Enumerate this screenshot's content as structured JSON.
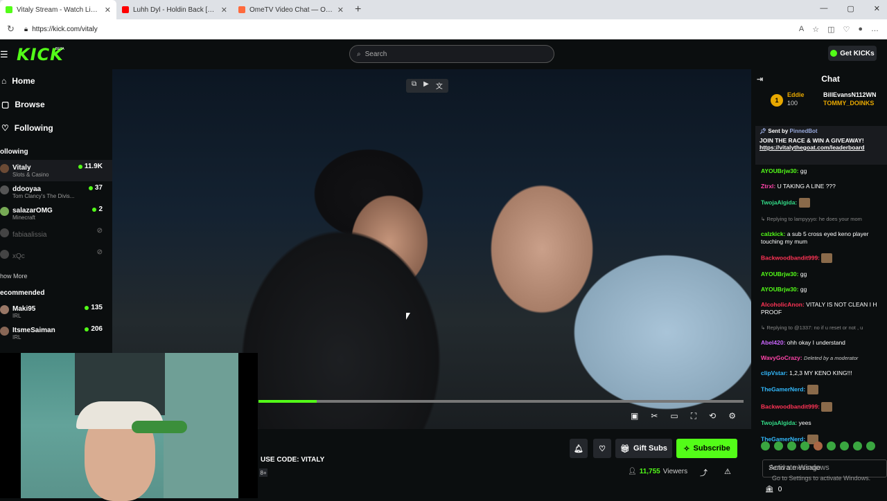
{
  "browser": {
    "tabs": [
      {
        "title": "Vitaly Stream - Watch Live on",
        "color": "#53fc18",
        "active": true
      },
      {
        "title": "Luhh Dyl - Holdin Back [Official Vi",
        "color": "#ff0000",
        "active": false
      },
      {
        "title": "OmeTV Video Chat — Omegle",
        "color": "#ff6a3d",
        "active": false
      }
    ],
    "url": "https://kick.com/vitaly"
  },
  "header": {
    "logo": "KICK",
    "beta": "BETA",
    "search_placeholder": "Search",
    "get_kicks": "Get KICKs"
  },
  "sidebar": {
    "nav": [
      {
        "icon": "⌂",
        "label": "Home"
      },
      {
        "icon": "▢",
        "label": "Browse"
      },
      {
        "icon": "♡",
        "label": "Following"
      }
    ],
    "following_heading": "ollowing",
    "following": [
      {
        "name": "Vitaly",
        "category": "Slots & Casino",
        "viewers": "11.9K",
        "live": true
      },
      {
        "name": "ddooyaa",
        "category": "Tom Clancy's The Divis...",
        "viewers": "37",
        "live": true
      },
      {
        "name": "salazarOMG",
        "category": "Minecraft",
        "viewers": "2",
        "live": true
      },
      {
        "name": "fabiaalissia",
        "category": "",
        "viewers": "",
        "live": false
      },
      {
        "name": "xQc",
        "category": "",
        "viewers": "",
        "live": false
      }
    ],
    "show_more": "how More",
    "recommended_heading": "ecommended",
    "recommended": [
      {
        "name": "Maki95",
        "category": "IRL",
        "viewers": "135"
      },
      {
        "name": "ItsmeSaiman",
        "category": "IRL",
        "viewers": "206"
      }
    ]
  },
  "player": {
    "progress": 0.12,
    "code_text": "USE CODE: VITALY",
    "tag": "8+",
    "gift_subs": "Gift Subs",
    "subscribe": "Subscribe",
    "viewer_count": "11,755",
    "viewers_label": "Viewers"
  },
  "chat": {
    "title": "Chat",
    "leaders": {
      "rank": "1",
      "top_name": "Eddie",
      "top_value": "100",
      "gifter1": "BillEvansN112WN",
      "gifter2": "TOMMY_DOINKS"
    },
    "pinned": {
      "sent_by": "Sent by",
      "bot": "PinnedBot",
      "message": "JOIN THE RACE & WIN A GIVEAWAY!",
      "link": "https://vitalythegoat.com/leaderboard"
    },
    "messages": [
      {
        "user": "AYOUBrjw30:",
        "color": "#53fc18",
        "text": "gg"
      },
      {
        "user": "Ztrxl:",
        "color": "#ff44aa",
        "text": "U TAKING A LINE ???"
      },
      {
        "user": "TwojaAlgida:",
        "color": "#33dd88",
        "text": ""
      },
      {
        "reply": "Replying to lampyyyo: he does your mom"
      },
      {
        "user": "calzkick:",
        "color": "#53fc18",
        "text": "a sub 5 cross eyed keno player touching my mum"
      },
      {
        "user": "Backwoodbandit999:",
        "color": "#ff3355",
        "text": ""
      },
      {
        "user": "AYOUBrjw30:",
        "color": "#53fc18",
        "text": "gg"
      },
      {
        "user": "AYOUBrjw30:",
        "color": "#53fc18",
        "text": "gg"
      },
      {
        "user": "AlcoholicAnon:",
        "color": "#ff3355",
        "text": "VITALY IS NOT CLEAN I H PROOF"
      },
      {
        "reply": "Replying to @1337: no if u reset or not , u"
      },
      {
        "user": "Abel420:",
        "color": "#cc66ff",
        "text": "ohh okay I understand"
      },
      {
        "user": "WavyGoCrazy:",
        "color": "#ff44aa",
        "deleted": "Deleted by a moderator"
      },
      {
        "user": "clipVstar:",
        "color": "#33bbff",
        "text": "1,2,3 MY KENO KING!!!"
      },
      {
        "user": "TheGamerNerd:",
        "color": "#33bbff",
        "text": ""
      },
      {
        "user": "Backwoodbandit999:",
        "color": "#ff3355",
        "text": ""
      },
      {
        "user": "TwojaAlgida:",
        "color": "#33dd88",
        "text": "yees"
      },
      {
        "user": "TheGamerNerd:",
        "color": "#33bbff",
        "text": ""
      }
    ],
    "input_placeholder": "Send a message",
    "count": "0"
  },
  "watermark": {
    "line1": "Activate Windows",
    "line2": "Go to Settings to activate Windows."
  }
}
